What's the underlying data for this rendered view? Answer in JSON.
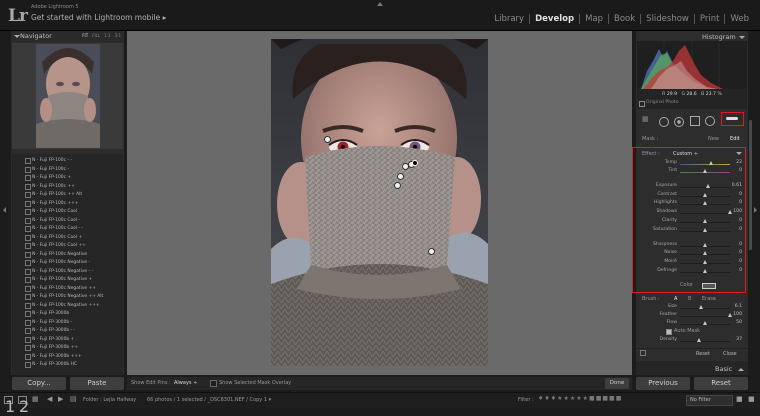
{
  "app": {
    "logo": "Lr",
    "name": "Adobe Lightroom 5",
    "subtitle": "Get started with Lightroom mobile ▸"
  },
  "modules": [
    "Library",
    "Develop",
    "Map",
    "Book",
    "Slideshow",
    "Print",
    "Web"
  ],
  "navigator": {
    "title": "Navigator",
    "zoom": [
      "FIT",
      "FILL",
      "1:1",
      "3:1"
    ]
  },
  "presets": [
    "N - Fuji FP-100c - -",
    "N - Fuji FP-100c -",
    "N - Fuji FP-100c +",
    "N - Fuji FP-100c ++",
    "N - Fuji FP-100c ++ Alt",
    "N - Fuji FP-100c +++",
    "N - Fuji FP-100c Cool",
    "N - Fuji FP-100c Cool -",
    "N - Fuji FP-100c Cool - -",
    "N - Fuji FP-100c Cool +",
    "N - Fuji FP-100c Cool ++",
    "N - Fuji FP-100c Negative",
    "N - Fuji FP-100c Negative -",
    "N - Fuji FP-100c Negative - -",
    "N - Fuji FP-100c Negative +",
    "N - Fuji FP-100c Negative ++",
    "N - Fuji FP-100c Negative ++ Alt",
    "N - Fuji FP-100c Negative +++",
    "N - Fuji FP-3000b",
    "N - Fuji FP-3000b -",
    "N - Fuji FP-3000b - -",
    "N - Fuji FP-3000b +",
    "N - Fuji FP-3000b ++",
    "N - Fuji FP-3000b +++",
    "N - Fuji FP-3000b HC"
  ],
  "left_buttons": {
    "copy": "Copy...",
    "paste": "Paste"
  },
  "toolbar": {
    "show_edit_pins_label": "Show Edit Pins :",
    "show_edit_pins_value": "Always ÷",
    "overlay_label": "Show Selected Mask Overlay",
    "done": "Done"
  },
  "histogram": {
    "title": "Histogram",
    "readout": [
      "R",
      "29.9",
      "G",
      "28.6",
      "B",
      "23.7",
      "%"
    ],
    "original_photo": "Original Photo"
  },
  "mask": {
    "label": "Mask :",
    "new": "New",
    "edit": "Edit"
  },
  "effect": {
    "label": "Effect :",
    "value": "Custom ÷"
  },
  "sliders": [
    {
      "name": "Temp",
      "value": "22",
      "pos": 0.62
    },
    {
      "name": "Tint",
      "value": "0",
      "pos": 0.5
    },
    {
      "name": "Exposure",
      "value": "0.61",
      "pos": 0.55
    },
    {
      "name": "Contrast",
      "value": "0",
      "pos": 0.5
    },
    {
      "name": "Highlights",
      "value": "0",
      "pos": 0.5
    },
    {
      "name": "Shadows",
      "value": "100",
      "pos": 1.0
    },
    {
      "name": "Clarity",
      "value": "0",
      "pos": 0.5
    },
    {
      "name": "Saturation",
      "value": "0",
      "pos": 0.5
    },
    {
      "name": "Sharpness",
      "value": "0",
      "pos": 0.5
    },
    {
      "name": "Noise",
      "value": "0",
      "pos": 0.5
    },
    {
      "name": "Moiré",
      "value": "0",
      "pos": 0.5
    },
    {
      "name": "Defringe",
      "value": "0",
      "pos": 0.5
    }
  ],
  "color_label": "Color",
  "brush": {
    "label": "Brush :",
    "a": "A",
    "b": "B",
    "erase": "Erase",
    "sliders": [
      {
        "name": "Size",
        "value": "6.1",
        "pos": 0.42
      },
      {
        "name": "Feather",
        "value": "100",
        "pos": 1.0
      },
      {
        "name": "Flow",
        "value": "50",
        "pos": 0.5
      }
    ],
    "auto_mask": "Auto Mask",
    "density": {
      "name": "Density",
      "value": "37",
      "pos": 0.37
    }
  },
  "reset": "Reset",
  "close": "Close",
  "basic": "Basic",
  "right_buttons": {
    "previous": "Previous",
    "reset": "Reset"
  },
  "filmstrip": {
    "pages": [
      "1",
      "2"
    ],
    "path": "Folder : Lejla Hallway",
    "count": "66 photos / 1 selected / _DSC6301.NEF / Copy 1 ▾",
    "filter_label": "Filter :",
    "filter_value": "No Filter"
  },
  "accent_red": "#e01b24"
}
